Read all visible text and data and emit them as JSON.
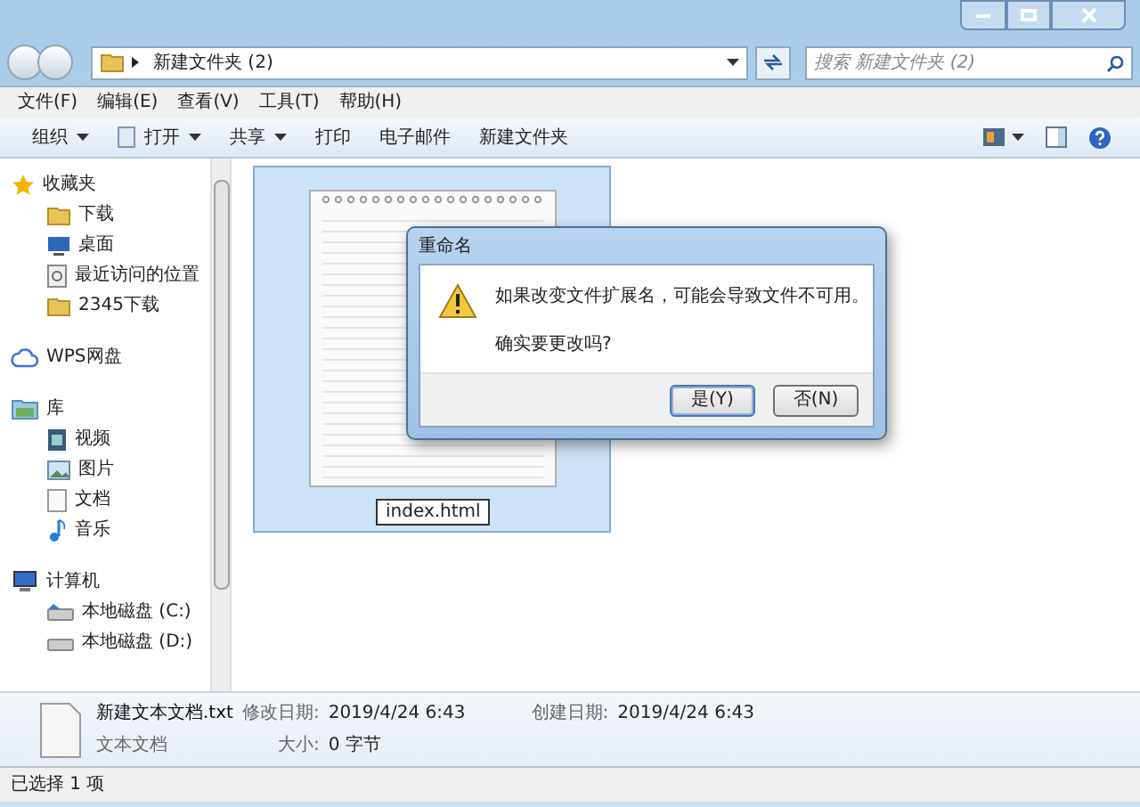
{
  "address_bar": {
    "path": "新建文件夹 (2)",
    "search_placeholder": "搜索 新建文件夹 (2)"
  },
  "menu": [
    "文件(F)",
    "编辑(E)",
    "查看(V)",
    "工具(T)",
    "帮助(H)"
  ],
  "toolbar": [
    {
      "label": "组织",
      "dropdown": true
    },
    {
      "label": "打开",
      "dropdown": true
    },
    {
      "label": "共享",
      "dropdown": true
    },
    {
      "label": "打印",
      "dropdown": false
    },
    {
      "label": "电子邮件",
      "dropdown": false
    },
    {
      "label": "新建文件夹",
      "dropdown": false
    }
  ],
  "sidebar": [
    {
      "label": "收藏夹",
      "children": [
        {
          "label": "下载"
        },
        {
          "label": "桌面"
        },
        {
          "label": "最近访问的位置"
        },
        {
          "label": "2345下载"
        }
      ]
    },
    {
      "label": "WPS网盘"
    },
    {
      "label": "库",
      "children": [
        {
          "label": "视频"
        },
        {
          "label": "图片"
        },
        {
          "label": "文档"
        },
        {
          "label": "音乐"
        }
      ]
    },
    {
      "label": "计算机",
      "children": [
        {
          "label": "本地磁盘 (C:)"
        },
        {
          "label": "本地磁盘 (D:)"
        }
      ]
    }
  ],
  "file": {
    "rename_value": "index.html",
    "selected": true
  },
  "dialog": {
    "title": "重命名",
    "message": "如果改变文件扩展名，可能会导致文件不可用。",
    "question": "确实要更改吗?",
    "buttons": [
      {
        "label": "是(Y)",
        "default": true
      },
      {
        "label": "否(N)",
        "default": false
      }
    ]
  },
  "details": {
    "name": "新建文本文档.txt",
    "type": "文本文档",
    "modified_label": "修改日期:",
    "modified": "2019/4/24 6:43",
    "created_label": "创建日期:",
    "created": "2019/4/24 6:43",
    "size_label": "大小:",
    "size": "0 字节"
  },
  "status_bar": "已选择 1 项"
}
